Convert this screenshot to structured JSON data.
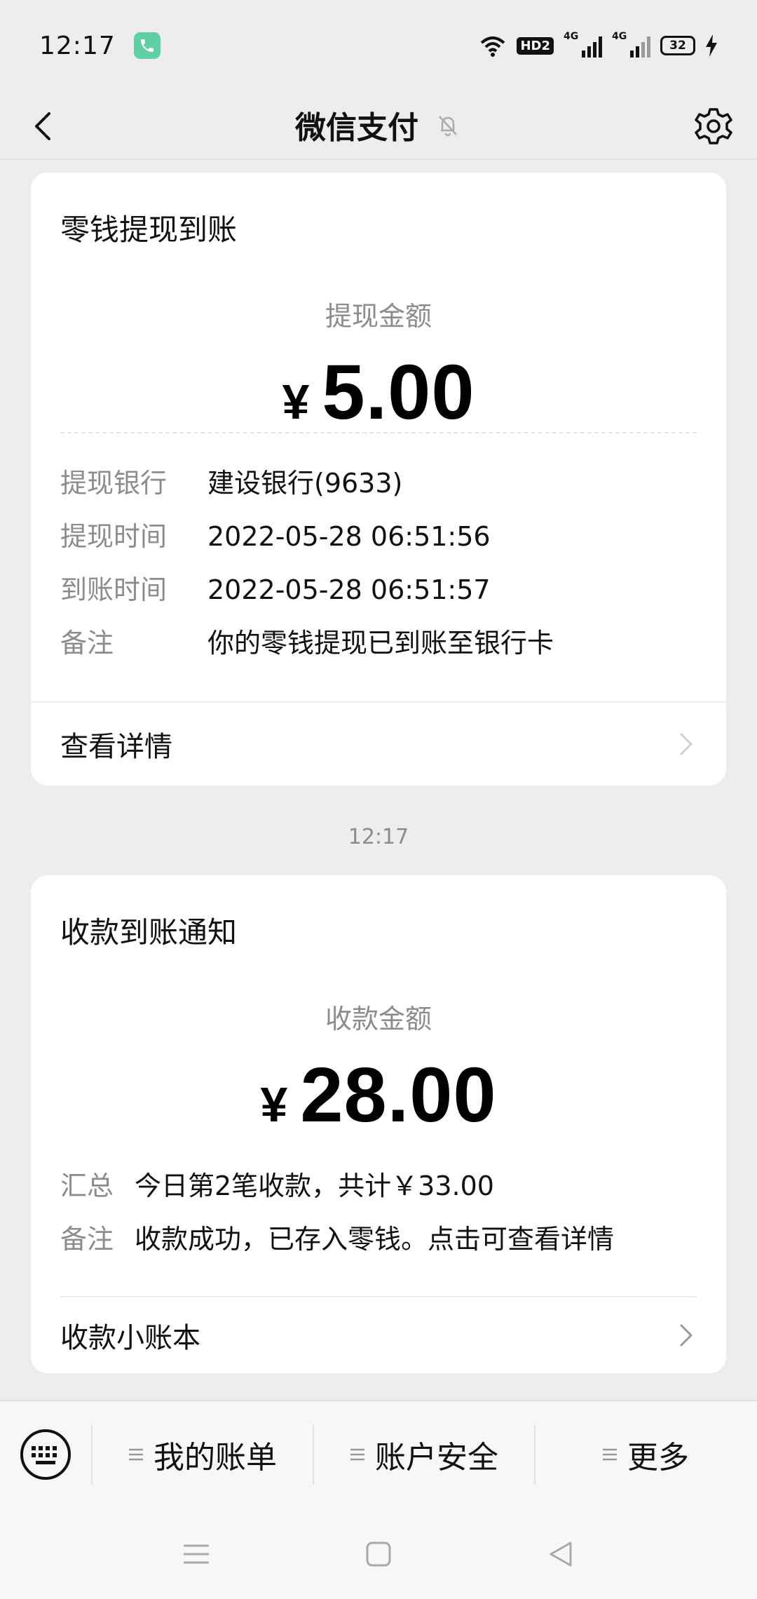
{
  "status_bar": {
    "time": "12:17",
    "hd": "HD2",
    "sig1": "4G",
    "sig2": "4G",
    "battery": "32"
  },
  "header": {
    "title": "微信支付"
  },
  "card1": {
    "title": "零钱提现到账",
    "amount_label": "提现金额",
    "currency": "¥",
    "amount": "5.00",
    "rows": [
      {
        "key": "提现银行",
        "value": "建设银行(9633)"
      },
      {
        "key": "提现时间",
        "value": "2022-05-28 06:51:56"
      },
      {
        "key": "到账时间",
        "value": "2022-05-28 06:51:57"
      },
      {
        "key": "备注",
        "value": "你的零钱提现已到账至银行卡"
      }
    ],
    "link": "查看详情"
  },
  "timestamp": "12:17",
  "card2": {
    "title": "收款到账通知",
    "amount_label": "收款金额",
    "currency": "¥",
    "amount": "28.00",
    "rows": [
      {
        "key": "汇总",
        "value": "今日第2笔收款，共计￥33.00"
      },
      {
        "key": "备注",
        "value": "收款成功，已存入零钱。点击可查看详情"
      }
    ],
    "link": "收款小账本"
  },
  "bottom_menu": {
    "items": [
      "我的账单",
      "账户安全",
      "更多"
    ]
  },
  "colors": {
    "background": "#ededed",
    "card": "#ffffff",
    "muted_text": "#8c8c8c",
    "call_badge": "#5fd0a4"
  }
}
